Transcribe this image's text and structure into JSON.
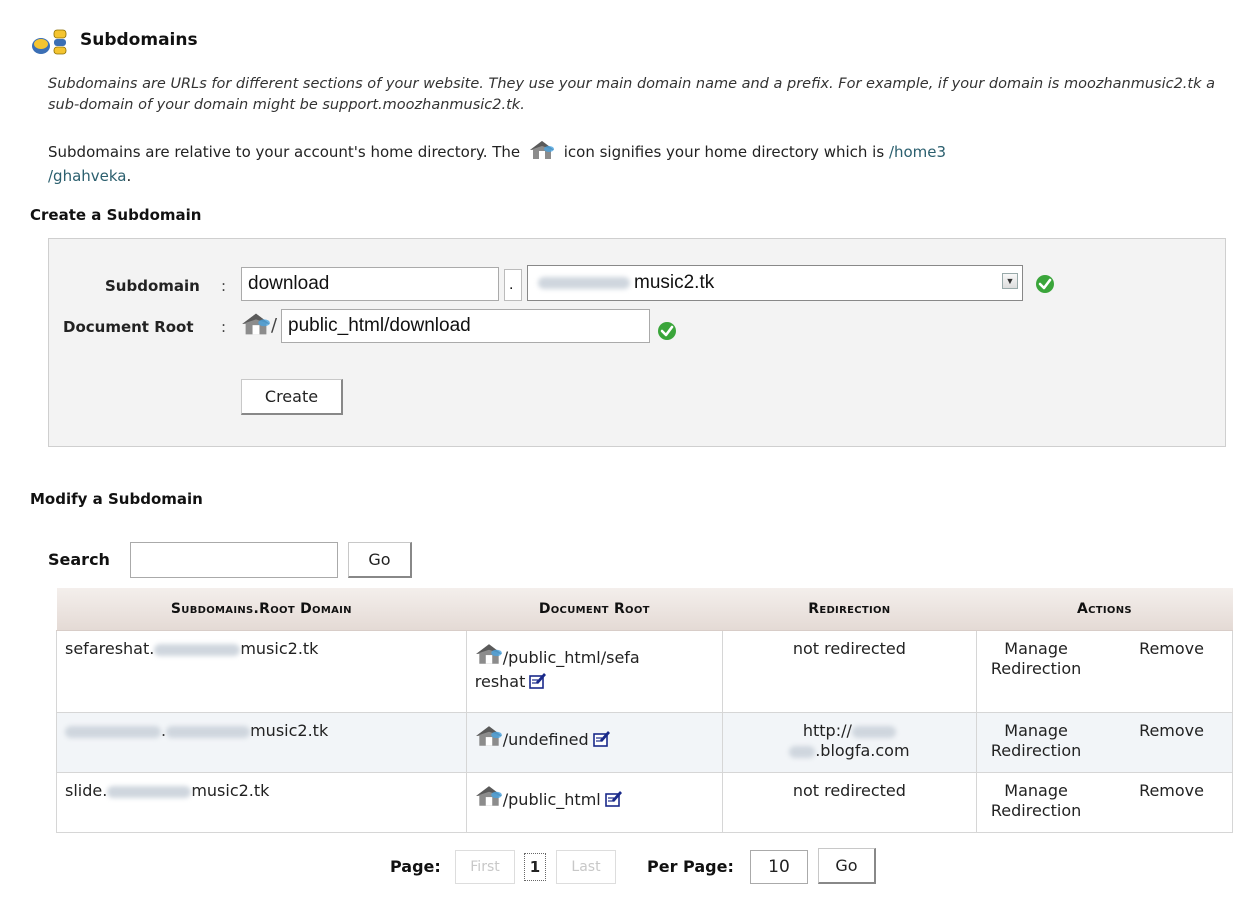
{
  "header": {
    "title": "Subdomains",
    "intro": "Subdomains are URLs for different sections of your website. They use your main domain name and a prefix. For example, if your domain is moozhanmusic2.tk a sub-domain of your domain might be support.moozhanmusic2.tk.",
    "home_note_before": "Subdomains are relative to your account's home directory. The",
    "home_note_after": "icon signifies your home directory which is",
    "home_path_line1": "/home3",
    "home_path_line2": "/ghahveka",
    "home_note_end": "."
  },
  "create": {
    "heading": "Create a Subdomain",
    "subdomain_label": "Subdomain",
    "subdomain_value": "download",
    "domain_suffix": "music2.tk",
    "docroot_label": "Document Root",
    "docroot_value": "public_html/download",
    "create_button": "Create",
    "colon": ":",
    "dot": ".",
    "slash": "/"
  },
  "modify": {
    "heading": "Modify a Subdomain",
    "search_label": "Search",
    "search_value": "",
    "go_button": "Go"
  },
  "table": {
    "headers": [
      "Subdomains.Root Domain",
      "Document Root",
      "Redirection",
      "Actions"
    ],
    "rows": [
      {
        "sub_prefix": "sefareshat.",
        "sub_suffix": "music2.tk",
        "docroot_a": "/public_html/sefa",
        "docroot_b": "reshat",
        "redirection": "not redirected",
        "manage_a": "Manage",
        "manage_b": "Redirection",
        "remove": "Remove"
      },
      {
        "sub_prefix": ".",
        "sub_suffix": "music2.tk",
        "docroot_a": "/undefined",
        "redir_a": "http://",
        "redir_b": ".blogfa.com",
        "manage_a": "Manage",
        "manage_b": "Redirection",
        "remove": "Remove"
      },
      {
        "sub_prefix": "slide.",
        "sub_suffix": "music2.tk",
        "docroot_a": "/public_html",
        "redirection": "not redirected",
        "manage_a": "Manage",
        "manage_b": "Redirection",
        "remove": "Remove"
      }
    ]
  },
  "pager": {
    "page_label": "Page:",
    "first": "First",
    "current": "1",
    "last": "Last",
    "perpage_label": "Per Page:",
    "perpage_value": "10",
    "go_button": "Go"
  },
  "icons": {
    "title": "subdomains-icon",
    "home": "house-icon",
    "ok": "checkmark-ok-icon",
    "edit": "edit-icon"
  },
  "colors": {
    "ok_green": "#3aa53a",
    "path_link": "#2b5f6e",
    "header_bg": "#e4dad5"
  }
}
